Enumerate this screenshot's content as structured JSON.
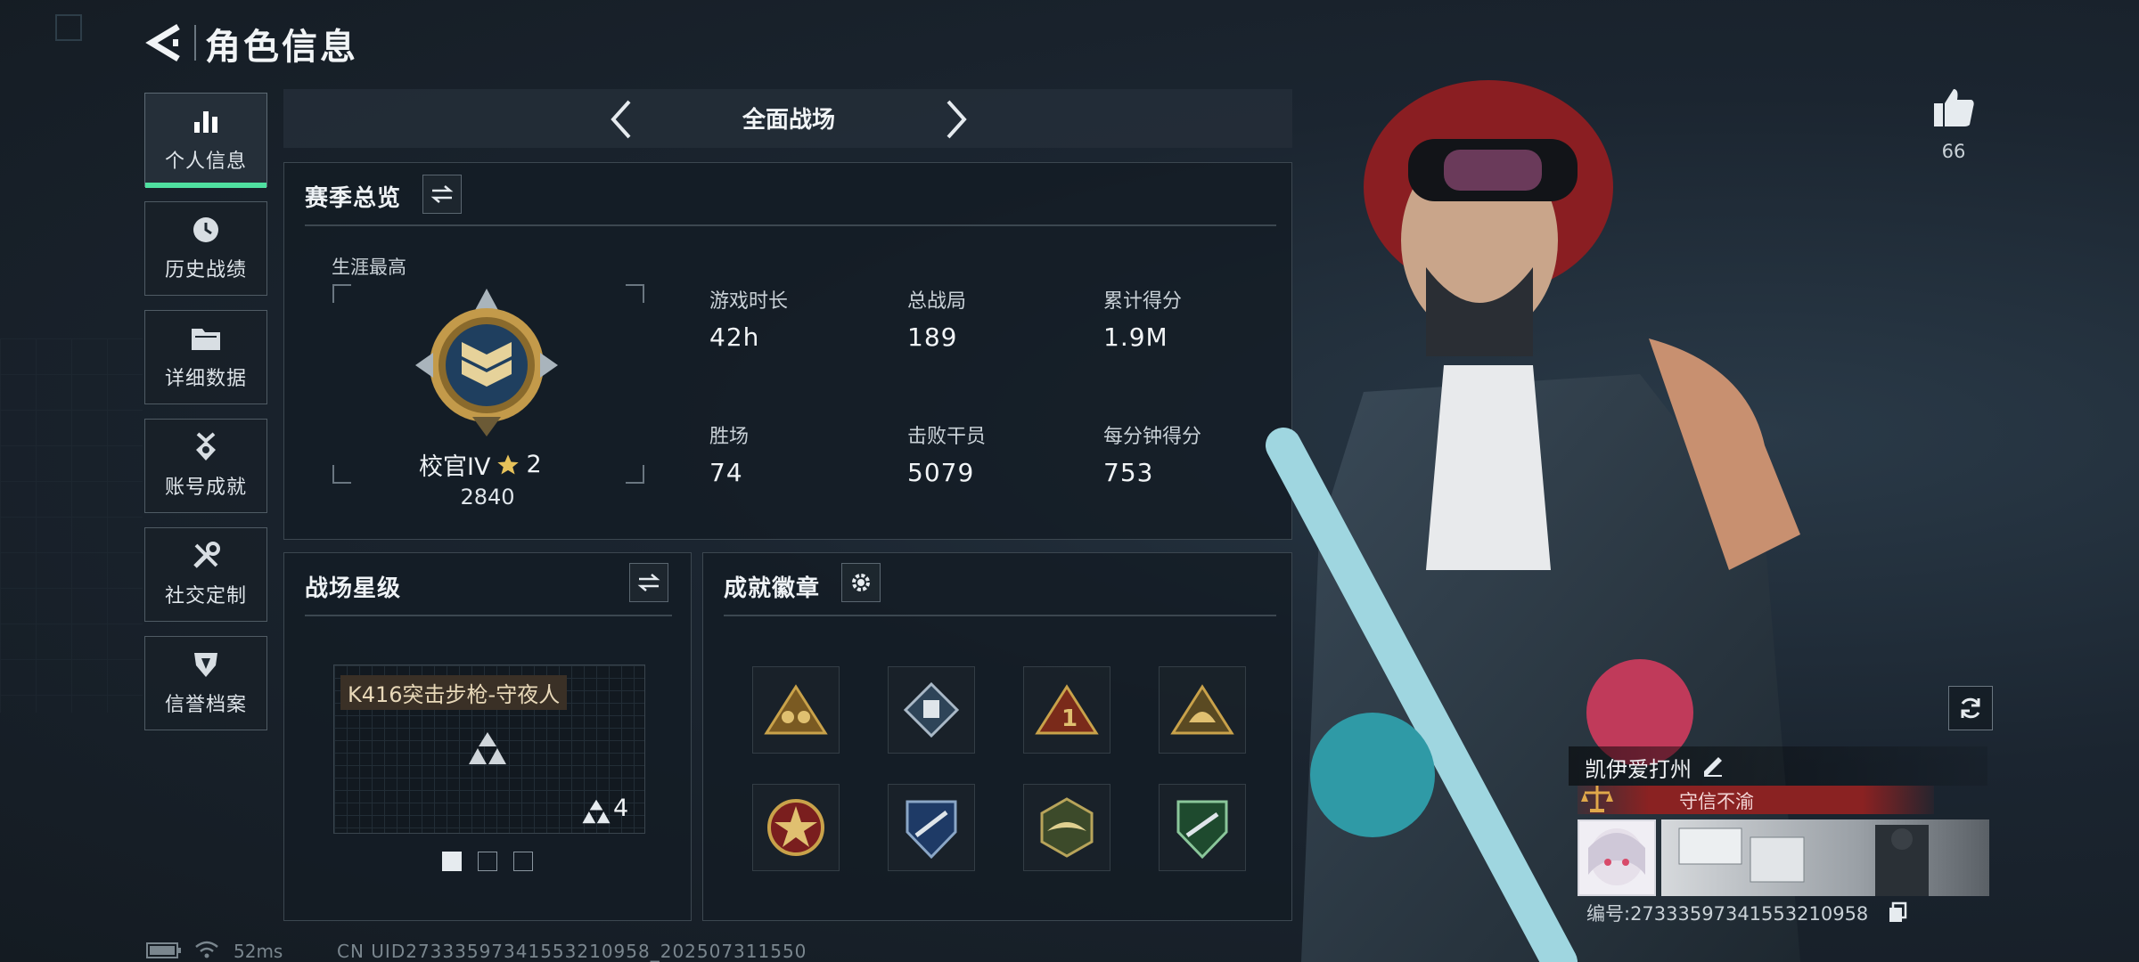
{
  "header": {
    "title": "角色信息"
  },
  "nav": [
    {
      "label": "个人信息",
      "icon": "bar-chart-icon",
      "active": true
    },
    {
      "label": "历史战绩",
      "icon": "clock-icon"
    },
    {
      "label": "详细数据",
      "icon": "folder-icon"
    },
    {
      "label": "账号成就",
      "icon": "medal-icon"
    },
    {
      "label": "社交定制",
      "icon": "tools-icon"
    },
    {
      "label": "信誉档案",
      "icon": "shield-icon"
    }
  ],
  "mode": {
    "label": "全面战场"
  },
  "season": {
    "title": "赛季总览",
    "career_label": "生涯最高",
    "rank_name": "校官IV",
    "rank_stars": "2",
    "rank_points": "2840",
    "stats": [
      {
        "label": "游戏时长",
        "value": "42h"
      },
      {
        "label": "总战局",
        "value": "189"
      },
      {
        "label": "累计得分",
        "value": "1.9M"
      },
      {
        "label": "胜场",
        "value": "74"
      },
      {
        "label": "击败干员",
        "value": "5079"
      },
      {
        "label": "每分钟得分",
        "value": "753"
      }
    ]
  },
  "star_level": {
    "title": "战场星级",
    "weapon_name": "K416突击步枪-守夜人",
    "star_count": "4"
  },
  "achievements": {
    "title": "成就徽章",
    "badges": [
      "warriors-badge-icon",
      "diamond-badge-icon",
      "number-one-badge-icon",
      "helmet-badge-icon",
      "star-badge-icon",
      "sniper-badge-icon",
      "wings-badge-icon",
      "rifle-badge-icon"
    ]
  },
  "likes": {
    "count": "66"
  },
  "profile": {
    "name": "凯伊爱打州",
    "tag": "守信不渝",
    "id_text": "编号:27333597341553210958"
  },
  "status_bar": {
    "ping": "52ms",
    "uid": "CN UID27333597341553210958_202507311550"
  },
  "colors": {
    "accent_green": "#4fe0a0",
    "tag_red": "#8a2222",
    "gold": "#c9a24a"
  }
}
